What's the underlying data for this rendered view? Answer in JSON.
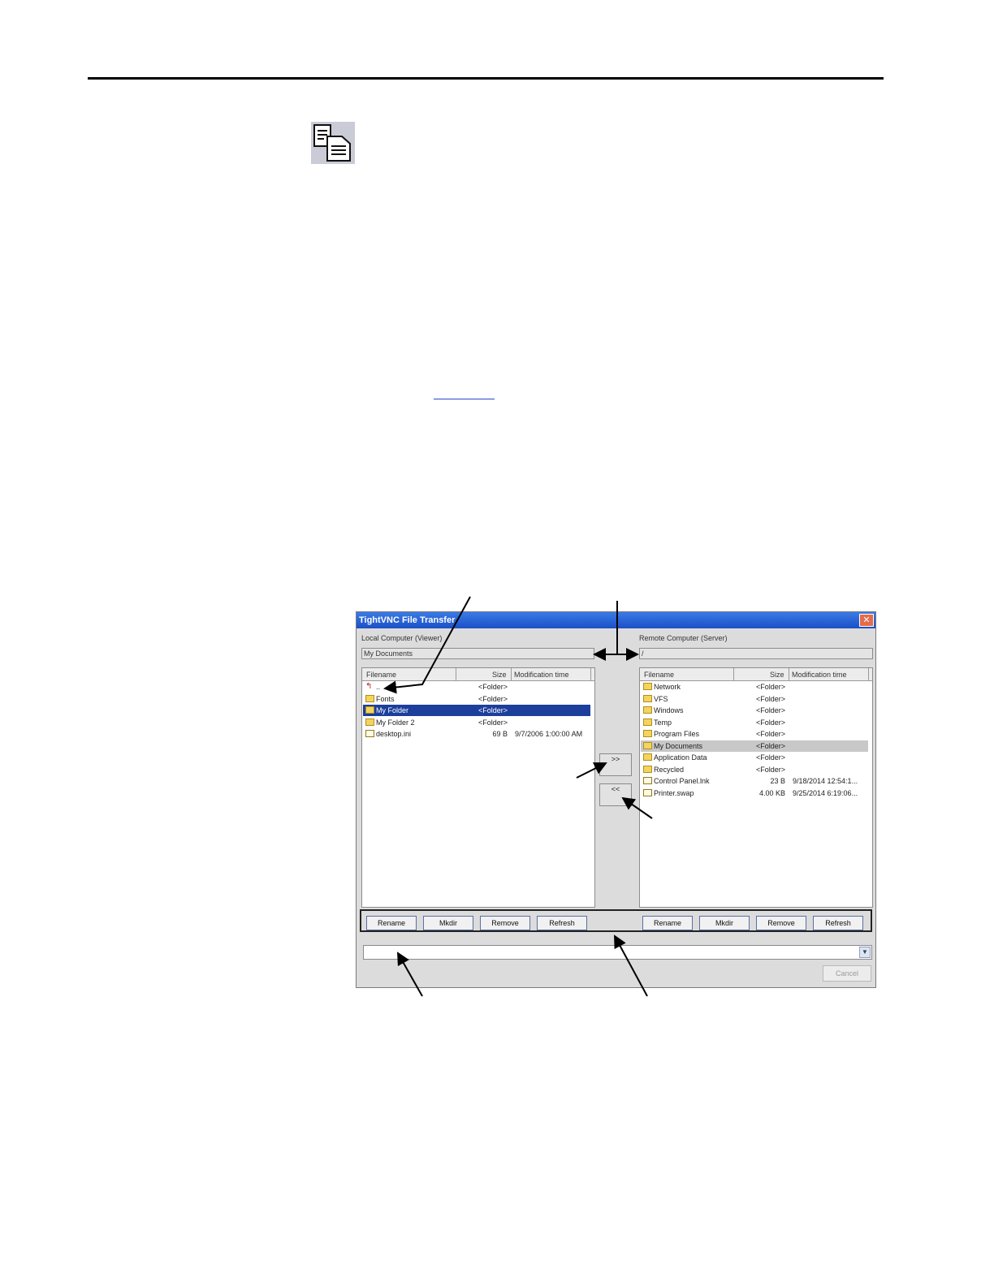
{
  "page": {
    "doc_icon": "copy-documents-icon"
  },
  "window": {
    "title": "TightVNC File Transfer",
    "close_glyph": "✕",
    "local_label": "Local Computer (Viewer)",
    "remote_label": "Remote Computer (Server)",
    "local_path": "My Documents",
    "remote_path": "/",
    "columns": {
      "filename": "Filename",
      "size": "Size",
      "modified": "Modification time"
    },
    "local_rows": [
      {
        "icon": "up-folder-icon",
        "name": "..",
        "size": "<Folder>",
        "modified": ""
      },
      {
        "icon": "folder-icon",
        "name": "Fonts",
        "size": "<Folder>",
        "modified": ""
      },
      {
        "icon": "folder-icon",
        "name": "My Folder",
        "size": "<Folder>",
        "modified": "",
        "selected": true
      },
      {
        "icon": "folder-icon",
        "name": "My Folder 2",
        "size": "<Folder>",
        "modified": ""
      },
      {
        "icon": "file-icon",
        "name": "desktop.ini",
        "size": "69 B",
        "modified": "9/7/2006 1:00:00 AM"
      }
    ],
    "remote_rows": [
      {
        "icon": "folder-icon",
        "name": "Network",
        "size": "<Folder>",
        "modified": ""
      },
      {
        "icon": "folder-icon",
        "name": "VFS",
        "size": "<Folder>",
        "modified": ""
      },
      {
        "icon": "folder-icon",
        "name": "Windows",
        "size": "<Folder>",
        "modified": ""
      },
      {
        "icon": "folder-icon",
        "name": "Temp",
        "size": "<Folder>",
        "modified": ""
      },
      {
        "icon": "folder-icon",
        "name": "Program Files",
        "size": "<Folder>",
        "modified": ""
      },
      {
        "icon": "folder-icon",
        "name": "My Documents",
        "size": "<Folder>",
        "modified": "",
        "highlighted": true
      },
      {
        "icon": "folder-icon",
        "name": "Application Data",
        "size": "<Folder>",
        "modified": ""
      },
      {
        "icon": "folder-icon",
        "name": "Recycled",
        "size": "<Folder>",
        "modified": ""
      },
      {
        "icon": "file-icon",
        "name": "Control Panel.lnk",
        "size": "23 B",
        "modified": "9/18/2014 12:54:1..."
      },
      {
        "icon": "file-icon",
        "name": "Printer.swap",
        "size": "4.00 KB",
        "modified": "9/25/2014 6:19:06..."
      }
    ],
    "upload_label": ">>",
    "download_label": "<<",
    "buttons": {
      "rename": "Rename",
      "mkdir": "Mkdir",
      "remove": "Remove",
      "refresh": "Refresh"
    },
    "cancel_label": "Cancel"
  }
}
